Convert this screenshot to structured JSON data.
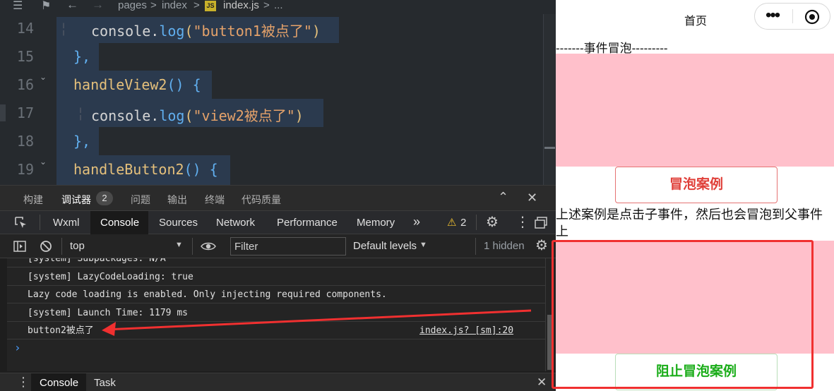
{
  "editor": {
    "breadcrumb": {
      "part1": "pages",
      "sep1": ">",
      "part2": "index",
      "sep2": ">",
      "file_icon": "JS",
      "part3": "index.js",
      "sep3": ">",
      "part4": "..."
    },
    "lines": [
      {
        "num": "14",
        "t1": "console.",
        "t2": "log",
        "t3": "(",
        "t4": "\"button1被点了\"",
        "t5": ")"
      },
      {
        "num": "15",
        "t1": "},"
      },
      {
        "num": "16",
        "t1": "handleView2",
        "t2": "() {"
      },
      {
        "num": "17",
        "t1": "console.",
        "t2": "log",
        "t3": "(",
        "t4": "\"view2被点了\"",
        "t5": ")"
      },
      {
        "num": "18",
        "t1": "},"
      },
      {
        "num": "19",
        "t1": "handleButton2",
        "t2": "() {"
      }
    ]
  },
  "panel_tabs": [
    "构建",
    "调试器",
    "问题",
    "输出",
    "终端",
    "代码质量"
  ],
  "debugger_badge": "2",
  "dev_tabs": [
    "Wxml",
    "Console",
    "Sources",
    "Network",
    "Performance",
    "Memory"
  ],
  "more_tabs": "»",
  "warning_count": "2",
  "filter_bar": {
    "context": "top",
    "filter_placeholder": "Filter",
    "levels": "Default levels",
    "hidden": "1 hidden"
  },
  "console_lines": [
    "[system] Subpackages: N/A",
    "[system] LazyCodeLoading: true",
    "Lazy code loading is enabled. Only injecting required components.",
    "[system] Launch Time: 1179 ms"
  ],
  "log_entry": {
    "text": "button2被点了",
    "source": "index.js? [sm]:20"
  },
  "prompt": "›",
  "bottom_tabs": [
    "Console",
    "Task"
  ],
  "phone": {
    "title": "首页",
    "section_title": "-------事件冒泡---------",
    "button1": "冒泡案例",
    "description": "上述案例是点击子事件，然后也会冒泡到父事件上",
    "button2": "阻止冒泡案例"
  },
  "colors": {
    "annotation_red": "#f03030",
    "pink": "#ffc0cb",
    "red_text": "#e0403a",
    "green_text": "#1aad19"
  }
}
